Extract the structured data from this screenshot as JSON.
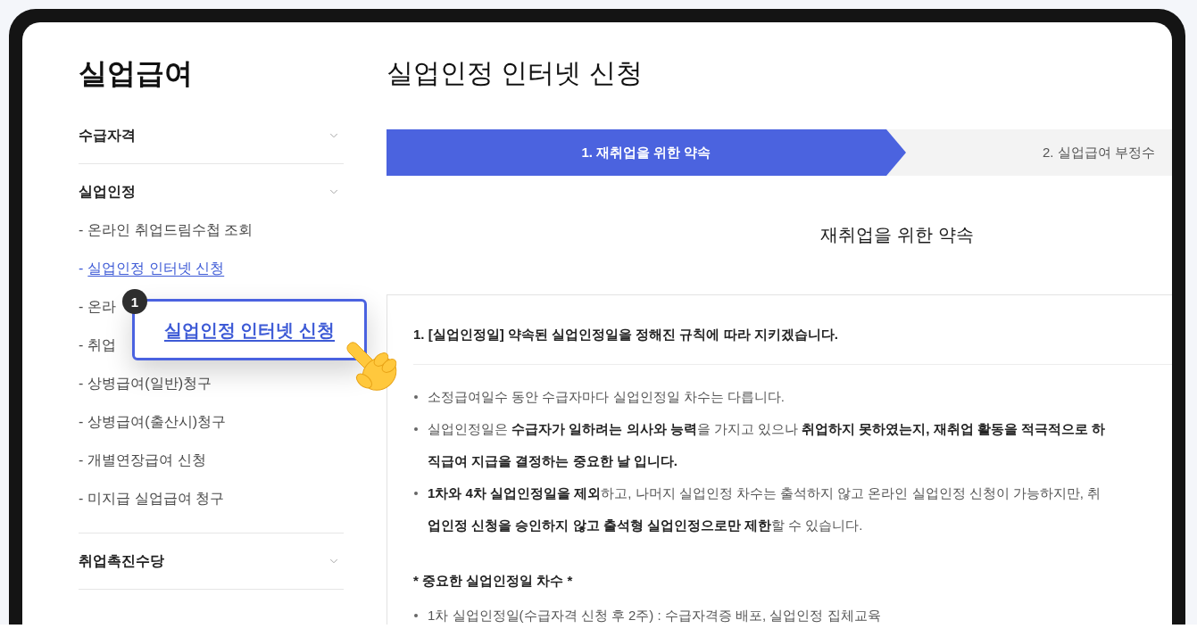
{
  "sidebar": {
    "title": "실업급여",
    "groups": [
      {
        "label": "수급자격"
      },
      {
        "label": "실업인정",
        "items": [
          {
            "bullet": "-",
            "label": "온라인 취업드림수첩 조회",
            "selected": false
          },
          {
            "bullet": "-",
            "label": "실업인정 인터넷 신청",
            "selected": true
          },
          {
            "bullet": "-",
            "label": "온라",
            "selected": false
          },
          {
            "bullet": "-",
            "label": "취업",
            "selected": false
          },
          {
            "bullet": "-",
            "label": "상병급여(일반)청구",
            "selected": false
          },
          {
            "bullet": "-",
            "label": "상병급여(출산시)청구",
            "selected": false
          },
          {
            "bullet": "-",
            "label": "개별연장급여 신청",
            "selected": false
          },
          {
            "bullet": "-",
            "label": "미지급 실업급여 청구",
            "selected": false
          }
        ]
      },
      {
        "label": "취업촉진수당"
      }
    ]
  },
  "callout": {
    "badge": "1",
    "label": "실업인정 인터넷 신청"
  },
  "page_title": "실업인정 인터넷 신청",
  "steps": [
    {
      "label": "1. 재취업을 위한 약속",
      "selected": true
    },
    {
      "label": "2. 실업급여 부정수",
      "selected": false
    }
  ],
  "section_title": "재취업을 위한 약속",
  "panel": {
    "heading": "1. [실업인정일] 약속된 실업인정일을 정해진 규칙에 따라 지키겠습니다.",
    "bullets": [
      {
        "lines": [
          "소정급여일수 동안 수급자마다 실업인정일 차수는 다릅니다."
        ]
      },
      {
        "lines": [
          "실업인정일은 **수급자가 일하려는 의사와 능력**을 가지고 있으나 **취업하지 못하였는지, 재취업 활동을 적극적으로 하**",
          "**직급여 지급을 결정하는 중요한 날 입니다.**"
        ]
      },
      {
        "lines": [
          "**1차와 4차 실업인정일을 제외**하고, 나머지 실업인정 차수는 출석하지 않고 온라인 실업인정 신청이 가능하지만, 취",
          "**업인정 신청을 승인하지 않고 출석형 실업인정으로만 제한**할 수 있습니다."
        ]
      }
    ],
    "note_title": "* 중요한 실업인정일 차수 *",
    "note_bullets": [
      {
        "lines": [
          "1차 실업인정일(수급자격 신청 후 2주) : 수급자격증 배포, 실업인정 집체교육"
        ]
      }
    ]
  }
}
